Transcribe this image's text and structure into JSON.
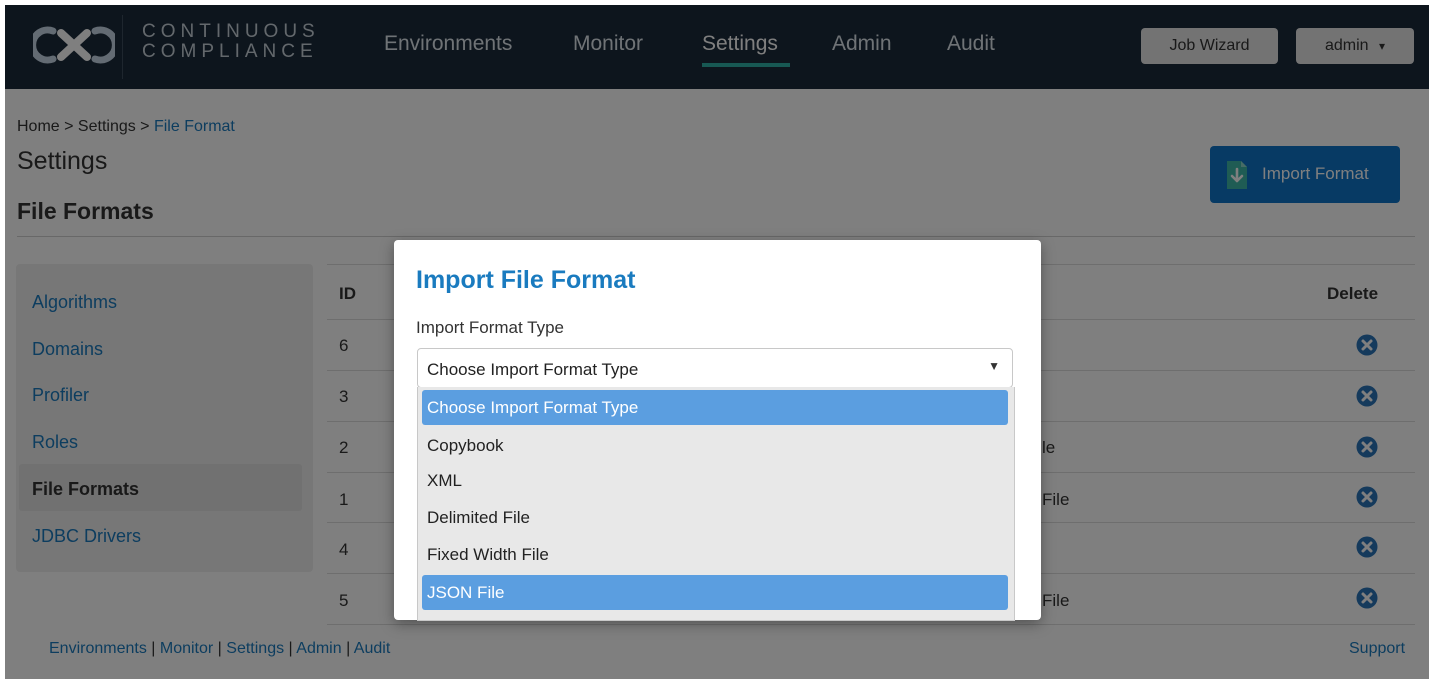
{
  "brand": {
    "line1": "CONTINUOUS",
    "line2": "COMPLIANCE"
  },
  "nav": {
    "items": [
      "Environments",
      "Monitor",
      "Settings",
      "Admin",
      "Audit"
    ],
    "active": "Settings",
    "job_wizard": "Job Wizard",
    "user": "admin",
    "user_caret": "▾"
  },
  "breadcrumb": {
    "home": "Home",
    "sep": " > ",
    "settings": "Settings",
    "current": "File Format"
  },
  "page": {
    "title": "Settings",
    "section": "File Formats",
    "import_button": "Import Format"
  },
  "sidebar": {
    "items": [
      "Algorithms",
      "Domains",
      "Profiler",
      "Roles",
      "File Formats",
      "JDBC Drivers"
    ],
    "active": "File Formats"
  },
  "table": {
    "headers": {
      "id": "ID",
      "delete": "Delete"
    },
    "rows": [
      {
        "id": "6",
        "partial": ""
      },
      {
        "id": "3",
        "partial": ""
      },
      {
        "id": "2",
        "partial": "le"
      },
      {
        "id": "1",
        "partial": "File"
      },
      {
        "id": "4",
        "partial": ""
      },
      {
        "id": "5",
        "partial": "File"
      }
    ]
  },
  "footer": {
    "links": [
      "Environments",
      "Monitor",
      "Settings",
      "Admin",
      "Audit"
    ],
    "separator": " | ",
    "support": "Support"
  },
  "modal": {
    "title": "Import File Format",
    "field_label": "Import Format Type",
    "select_value": "Choose Import Format Type",
    "options": [
      "Choose Import Format Type",
      "Copybook",
      "XML",
      "Delimited File",
      "Fixed Width File",
      "JSON File"
    ],
    "highlighted": [
      "Choose Import Format Type",
      "JSON File"
    ]
  },
  "colors": {
    "navbar": "#1b2b3b",
    "accent_blue": "#0e74c9",
    "link_blue": "#1a7bbf",
    "nav_underline": "#2fb0a6",
    "option_highlight": "#5b9ee0"
  }
}
